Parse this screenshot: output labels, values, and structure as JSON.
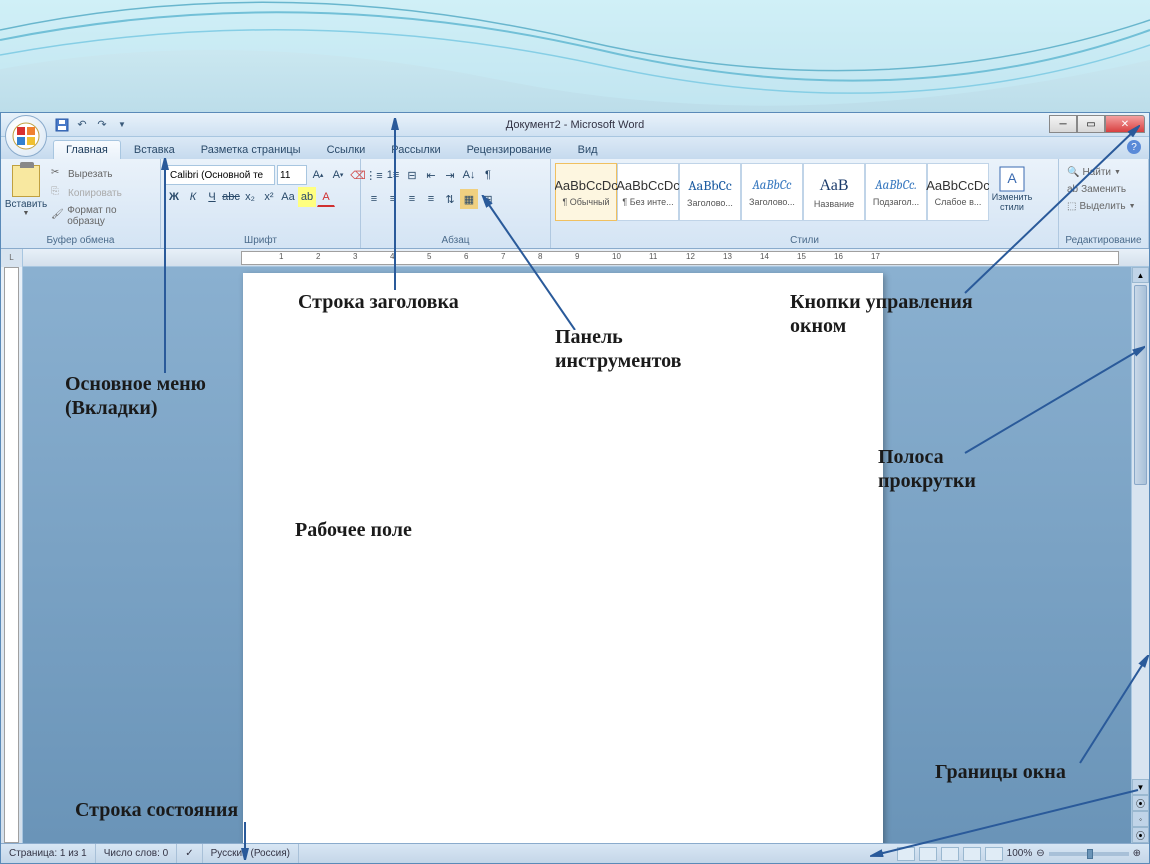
{
  "title_bar": {
    "title": "Документ2 - Microsoft Word"
  },
  "tabs": {
    "home": "Главная",
    "insert": "Вставка",
    "layout": "Разметка страницы",
    "links": "Ссылки",
    "mailings": "Рассылки",
    "review": "Рецензирование",
    "view": "Вид"
  },
  "clipboard": {
    "paste": "Вставить",
    "cut": "Вырезать",
    "copy": "Копировать",
    "format_painter": "Формат по образцу",
    "group_label": "Буфер обмена"
  },
  "font": {
    "name": "Calibri (Основной те",
    "size": "11",
    "group_label": "Шрифт"
  },
  "paragraph": {
    "group_label": "Абзац"
  },
  "styles": {
    "group_label": "Стили",
    "change_styles": "Изменить стили",
    "items": [
      {
        "sample": "AaBbCcDc",
        "name": "¶ Обычный",
        "cls": ""
      },
      {
        "sample": "AaBbCcDc",
        "name": "¶ Без инте...",
        "cls": ""
      },
      {
        "sample": "AaBbCc",
        "name": "Заголово...",
        "cls": "h1"
      },
      {
        "sample": "AaBbCc",
        "name": "Заголово...",
        "cls": "h2"
      },
      {
        "sample": "АаВ",
        "name": "Название",
        "cls": "title"
      },
      {
        "sample": "AaBbCc.",
        "name": "Подзагол...",
        "cls": "h2"
      },
      {
        "sample": "AaBbCcDc",
        "name": "Слабое в...",
        "cls": ""
      }
    ]
  },
  "editing": {
    "find": "Найти",
    "replace": "Заменить",
    "select": "Выделить",
    "group_label": "Редактирование"
  },
  "status": {
    "page": "Страница: 1 из 1",
    "words": "Число слов: 0",
    "lang": "Русский (Россия)",
    "zoom": "100%"
  },
  "annotations": {
    "title_bar": "Строка заголовка",
    "main_menu": "Основное меню\n(Вкладки)",
    "toolbar": "Панель\nинструментов",
    "win_controls": "Кнопки управления\nокном",
    "scrollbar": "Полоса\nпрокрутки",
    "work_area": "Рабочее поле",
    "status_bar": "Строка состояния",
    "borders": "Границы окна"
  }
}
